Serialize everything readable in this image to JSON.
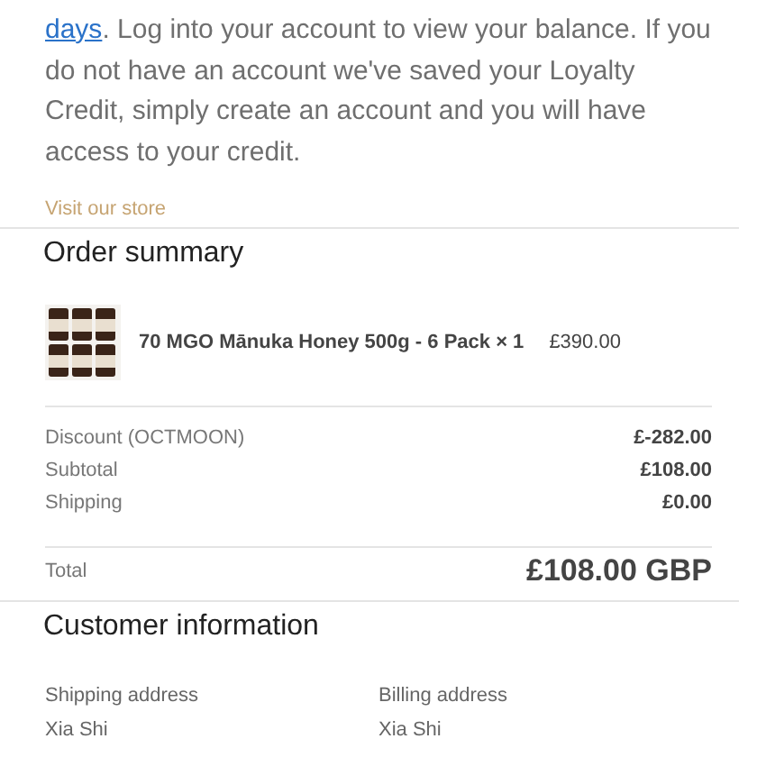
{
  "message": {
    "link": "days",
    "text": ". Log into your account to view your balance. If you do not have an account we've saved your Loyalty Credit, simply create an account and you will have access to your credit."
  },
  "store_link": "Visit our store",
  "order_summary": {
    "title": "Order summary",
    "items": [
      {
        "name": "70 MGO Mānuka Honey 500g - 6 Pack × 1",
        "price": "£390.00"
      }
    ],
    "lines": [
      {
        "label": "Discount (OCTMOON)",
        "value": "£-282.00"
      },
      {
        "label": "Subtotal",
        "value": "£108.00"
      },
      {
        "label": "Shipping",
        "value": "£0.00"
      }
    ],
    "total": {
      "label": "Total",
      "value": "£108.00 GBP"
    }
  },
  "customer_information": {
    "title": "Customer information",
    "addresses": [
      {
        "heading": "Shipping address",
        "name": "Xia Shi"
      },
      {
        "heading": "Billing address",
        "name": "Xia Shi"
      }
    ]
  }
}
